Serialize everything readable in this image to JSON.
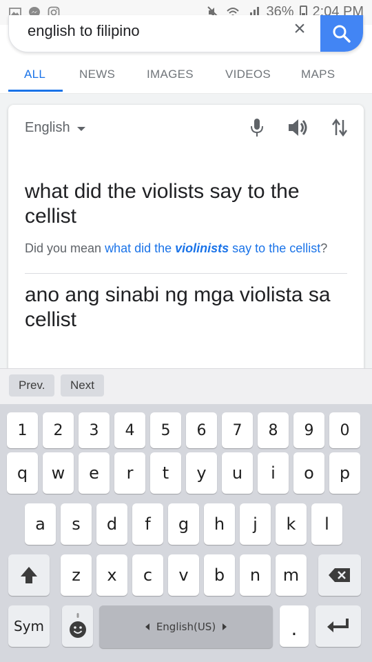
{
  "status_bar": {
    "left_icons": [
      "image-icon",
      "messenger-icon",
      "instagram-icon"
    ],
    "overflow": "...",
    "right_icons": [
      "mute-icon",
      "wifi-icon",
      "signal-icon"
    ],
    "battery": "36%",
    "time": "2:04 PM"
  },
  "search": {
    "query": "english to filipino"
  },
  "tabs": [
    {
      "label": "ALL",
      "active": true
    },
    {
      "label": "NEWS"
    },
    {
      "label": "IMAGES"
    },
    {
      "label": "VIDEOS"
    },
    {
      "label": "MAPS"
    }
  ],
  "translate": {
    "source_language": "English",
    "source_text": "what did the violists say to the cellist",
    "did_you_mean_prefix": "Did you mean ",
    "suggestion_before": "what did the ",
    "suggestion_bold": "violinists",
    "suggestion_after": " say to the cellist",
    "suggestion_end": "?",
    "translated_text": "ano ang sinabi ng mga violista sa cellist"
  },
  "nav_bar": {
    "prev_label": "Prev.",
    "next_label": "Next"
  },
  "keyboard": {
    "number_row": [
      "1",
      "2",
      "3",
      "4",
      "5",
      "6",
      "7",
      "8",
      "9",
      "0"
    ],
    "row1": [
      "q",
      "w",
      "e",
      "r",
      "t",
      "y",
      "u",
      "i",
      "o",
      "p"
    ],
    "row2": [
      "a",
      "s",
      "d",
      "f",
      "g",
      "h",
      "j",
      "k",
      "l"
    ],
    "row3": [
      "z",
      "x",
      "c",
      "v",
      "b",
      "n",
      "m"
    ],
    "sym_label": "Sym",
    "space_label": "English(US)",
    "period_label": "."
  },
  "colors": {
    "accent": "#1a73e8",
    "search_button": "#4285f4"
  }
}
